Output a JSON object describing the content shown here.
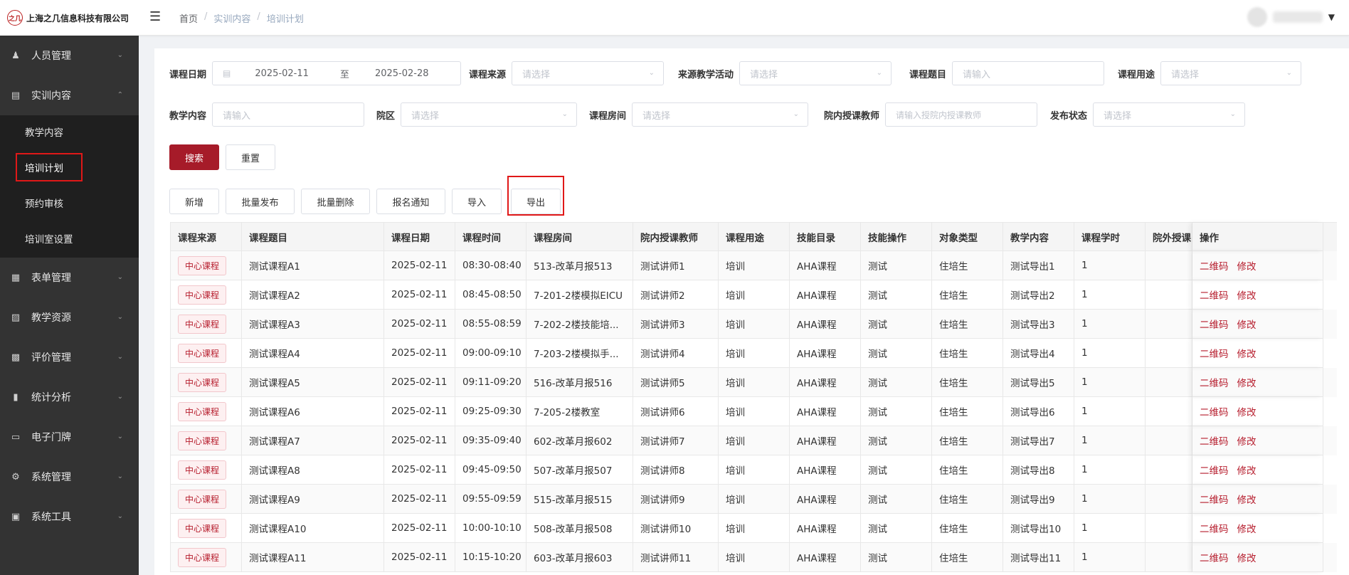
{
  "header": {
    "company_name": "上海之几信息科技有限公司",
    "logo_mark": "之几",
    "breadcrumb": [
      "首页",
      "实训内容",
      "培训计划"
    ]
  },
  "sidebar": {
    "items": [
      {
        "label": "人员管理",
        "icon": "user-icon",
        "expanded": false
      },
      {
        "label": "实训内容",
        "icon": "document-icon",
        "expanded": true,
        "children": [
          "教学内容",
          "培训计划",
          "预约审核",
          "培训室设置"
        ]
      },
      {
        "label": "表单管理",
        "icon": "form-icon",
        "expanded": false
      },
      {
        "label": "教学资源",
        "icon": "book-icon",
        "expanded": false
      },
      {
        "label": "评价管理",
        "icon": "evaluation-icon",
        "expanded": false
      },
      {
        "label": "统计分析",
        "icon": "bar-chart-icon",
        "expanded": false
      },
      {
        "label": "电子门牌",
        "icon": "monitor-icon",
        "expanded": false
      },
      {
        "label": "系统管理",
        "icon": "gear-icon",
        "expanded": false
      },
      {
        "label": "系统工具",
        "icon": "toolbox-icon",
        "expanded": false
      }
    ],
    "active_child": "培训计划"
  },
  "filters": {
    "date": {
      "label": "课程日期",
      "start": "2025-02-11",
      "sep": "至",
      "end": "2025-02-28"
    },
    "source": {
      "label": "课程来源",
      "placeholder": "请选择"
    },
    "source_activity": {
      "label": "来源教学活动",
      "placeholder": "请选择"
    },
    "topic": {
      "label": "课程题目",
      "placeholder": "请输入"
    },
    "purpose": {
      "label": "课程用途",
      "placeholder": "请选择"
    },
    "content": {
      "label": "教学内容",
      "placeholder": "请输入"
    },
    "campus": {
      "label": "院区",
      "placeholder": "请选择"
    },
    "room": {
      "label": "课程房间",
      "placeholder": "请选择"
    },
    "teacher": {
      "label": "院内授课教师",
      "placeholder": "请输入授院内授课教师"
    },
    "status": {
      "label": "发布状态",
      "placeholder": "请选择"
    }
  },
  "buttons": {
    "search": "搜索",
    "reset": "重置",
    "add": "新增",
    "batch_publish": "批量发布",
    "batch_delete": "批量删除",
    "signup_notice": "报名通知",
    "import": "导入",
    "export": "导出"
  },
  "colors": {
    "accent": "#a61b29",
    "sidebar_bg": "#333333",
    "highlight": "#e01818"
  },
  "table": {
    "columns": [
      "课程来源",
      "课程题目",
      "课程日期",
      "课程时间",
      "课程房间",
      "院内授课教师",
      "课程用途",
      "技能目录",
      "技能操作",
      "对象类型",
      "教学内容",
      "课程学时",
      "院外授课",
      "操作"
    ],
    "actions": [
      "二维码",
      "修改"
    ],
    "rows": [
      {
        "source": "中心课程",
        "topic": "测试课程A1",
        "date": "2025-02-11",
        "time": "08:30-08:40",
        "room": "513-改革月报513",
        "teacher": "测试讲师1",
        "purpose": "培训",
        "skill": "AHA课程",
        "op": "测试",
        "target": "住培生",
        "content": "测试导出1",
        "hours": "1",
        "ext": ""
      },
      {
        "source": "中心课程",
        "topic": "测试课程A2",
        "date": "2025-02-11",
        "time": "08:45-08:50",
        "room": "7-201-2楼模拟EICU",
        "teacher": "测试讲师2",
        "purpose": "培训",
        "skill": "AHA课程",
        "op": "测试",
        "target": "住培生",
        "content": "测试导出2",
        "hours": "1",
        "ext": ""
      },
      {
        "source": "中心课程",
        "topic": "测试课程A3",
        "date": "2025-02-11",
        "time": "08:55-08:59",
        "room": "7-202-2楼技能培...",
        "teacher": "测试讲师3",
        "purpose": "培训",
        "skill": "AHA课程",
        "op": "测试",
        "target": "住培生",
        "content": "测试导出3",
        "hours": "1",
        "ext": ""
      },
      {
        "source": "中心课程",
        "topic": "测试课程A4",
        "date": "2025-02-11",
        "time": "09:00-09:10",
        "room": "7-203-2楼模拟手...",
        "teacher": "测试讲师4",
        "purpose": "培训",
        "skill": "AHA课程",
        "op": "测试",
        "target": "住培生",
        "content": "测试导出4",
        "hours": "1",
        "ext": ""
      },
      {
        "source": "中心课程",
        "topic": "测试课程A5",
        "date": "2025-02-11",
        "time": "09:11-09:20",
        "room": "516-改革月报516",
        "teacher": "测试讲师5",
        "purpose": "培训",
        "skill": "AHA课程",
        "op": "测试",
        "target": "住培生",
        "content": "测试导出5",
        "hours": "1",
        "ext": ""
      },
      {
        "source": "中心课程",
        "topic": "测试课程A6",
        "date": "2025-02-11",
        "time": "09:25-09:30",
        "room": "7-205-2楼教室",
        "teacher": "测试讲师6",
        "purpose": "培训",
        "skill": "AHA课程",
        "op": "测试",
        "target": "住培生",
        "content": "测试导出6",
        "hours": "1",
        "ext": ""
      },
      {
        "source": "中心课程",
        "topic": "测试课程A7",
        "date": "2025-02-11",
        "time": "09:35-09:40",
        "room": "602-改革月报602",
        "teacher": "测试讲师7",
        "purpose": "培训",
        "skill": "AHA课程",
        "op": "测试",
        "target": "住培生",
        "content": "测试导出7",
        "hours": "1",
        "ext": ""
      },
      {
        "source": "中心课程",
        "topic": "测试课程A8",
        "date": "2025-02-11",
        "time": "09:45-09:50",
        "room": "507-改革月报507",
        "teacher": "测试讲师8",
        "purpose": "培训",
        "skill": "AHA课程",
        "op": "测试",
        "target": "住培生",
        "content": "测试导出8",
        "hours": "1",
        "ext": ""
      },
      {
        "source": "中心课程",
        "topic": "测试课程A9",
        "date": "2025-02-11",
        "time": "09:55-09:59",
        "room": "515-改革月报515",
        "teacher": "测试讲师9",
        "purpose": "培训",
        "skill": "AHA课程",
        "op": "测试",
        "target": "住培生",
        "content": "测试导出9",
        "hours": "1",
        "ext": ""
      },
      {
        "source": "中心课程",
        "topic": "测试课程A10",
        "date": "2025-02-11",
        "time": "10:00-10:10",
        "room": "508-改革月报508",
        "teacher": "测试讲师10",
        "purpose": "培训",
        "skill": "AHA课程",
        "op": "测试",
        "target": "住培生",
        "content": "测试导出10",
        "hours": "1",
        "ext": ""
      },
      {
        "source": "中心课程",
        "topic": "测试课程A11",
        "date": "2025-02-11",
        "time": "10:15-10:20",
        "room": "603-改革月报603",
        "teacher": "测试讲师11",
        "purpose": "培训",
        "skill": "AHA课程",
        "op": "测试",
        "target": "住培生",
        "content": "测试导出11",
        "hours": "1",
        "ext": ""
      }
    ]
  }
}
